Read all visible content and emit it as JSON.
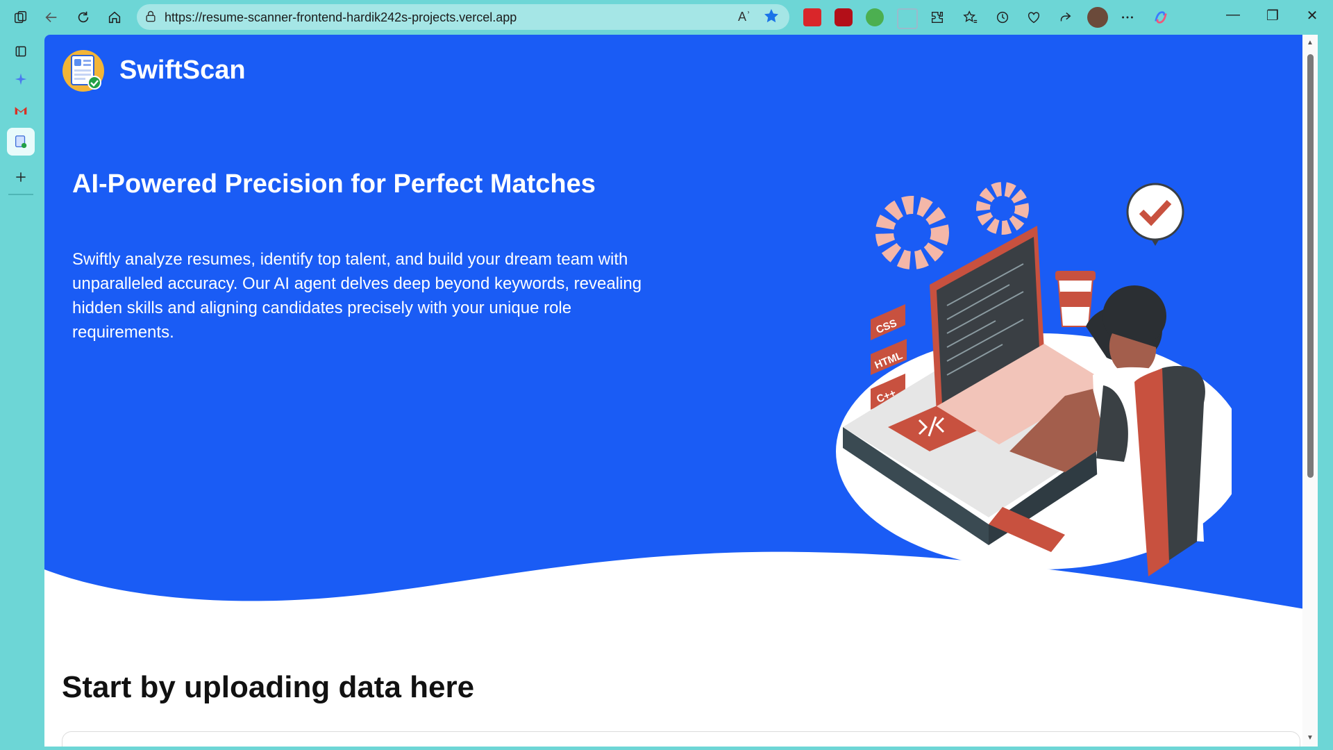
{
  "browser": {
    "url": "https://resume-scanner-frontend-hardik242s-projects.vercel.app",
    "read_aloud": "Aʾ"
  },
  "page": {
    "brand": "SwiftScan",
    "headline": "AI-Powered Precision for Perfect Matches",
    "subtext": "Swiftly analyze resumes, identify top talent, and build your dream team with unparalleled accuracy. Our AI agent delves deep beyond keywords, revealing hidden skills and aligning candidates precisely with your unique role requirements.",
    "upload_title": "Start by uploading data here",
    "illustration_labels": [
      "CSS",
      "HTML",
      "C++"
    ]
  },
  "colors": {
    "hero_blue": "#1a5cf5",
    "chrome_teal": "#6dd6d6",
    "accent_red": "#c8513f"
  }
}
